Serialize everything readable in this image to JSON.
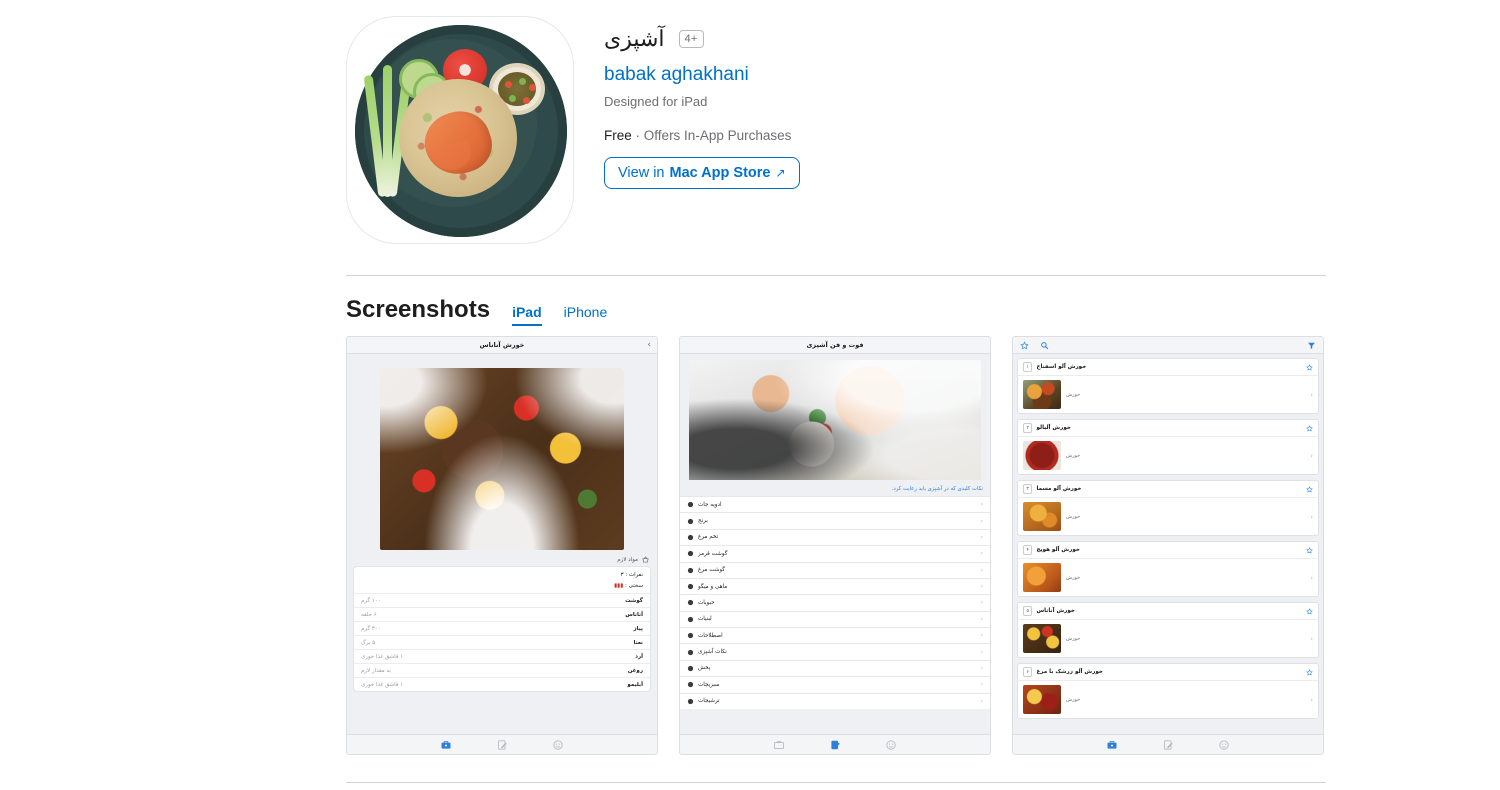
{
  "app": {
    "icon_name": "fried-rice-shrimp-plate",
    "title": "آشپزی",
    "age_rating": "4+",
    "developer": "babak aghakhani",
    "designed_for": "Designed for iPad",
    "price": "Free",
    "separator": "·",
    "in_app_purchases": "Offers In-App Purchases",
    "store_button": {
      "prefix": "View in ",
      "store": "Mac App Store",
      "arrow": "↗"
    }
  },
  "screenshots_section": {
    "heading": "Screenshots",
    "tabs": [
      {
        "label": "iPad",
        "active": true
      },
      {
        "label": "iPhone",
        "active": false
      }
    ]
  },
  "screenshot_1": {
    "title": "خورش آناناس",
    "chevron": "›",
    "ingredients_label": "مواد لازم",
    "servings": "نفرات : ۳",
    "difficulty": "سختی :",
    "rows": [
      {
        "name": "گوشت",
        "qty": "۱۰۰ گرم"
      },
      {
        "name": "آناناس",
        "qty": "۶ حلقه"
      },
      {
        "name": "پیاز",
        "qty": "۳۰۰ گرم"
      },
      {
        "name": "نعنا",
        "qty": "۵ برگ"
      },
      {
        "name": "آرد",
        "qty": "۱ قاشق غذا خوری"
      },
      {
        "name": "روغن",
        "qty": "به مقدار لازم"
      },
      {
        "name": "آبلیمو",
        "qty": "۱ قاشق غذا خوری"
      }
    ],
    "toolbar": [
      "smiley-icon",
      "note-edit-icon",
      "briefcase-icon"
    ],
    "toolbar_active_index": 2
  },
  "screenshot_2": {
    "title": "فوت و فن آشپزی",
    "note": "نکات کلیدی که در آشپزی باید رعایت کرد.",
    "rows": [
      {
        "label": "ادویه جات",
        "icon": "spice-icon"
      },
      {
        "label": "برنج",
        "icon": "rice-icon"
      },
      {
        "label": "تخم مرغ",
        "icon": "egg-icon"
      },
      {
        "label": "گوشت قرمز",
        "icon": "meat-icon"
      },
      {
        "label": "گوشت مرغ",
        "icon": "chicken-icon"
      },
      {
        "label": "ماهی و میگو",
        "icon": "fish-icon"
      },
      {
        "label": "حبوبات",
        "icon": "legume-icon"
      },
      {
        "label": "لبنیات",
        "icon": "dairy-icon"
      },
      {
        "label": "اصطلاحات",
        "icon": "list-icon"
      },
      {
        "label": "نکات آشپزی",
        "icon": "document-icon"
      },
      {
        "label": "پخش",
        "icon": "cook-icon"
      },
      {
        "label": "سبزیجات",
        "icon": "vegetable-icon"
      },
      {
        "label": "ترشیجات",
        "icon": "pickle-icon"
      }
    ],
    "chevron": "‹",
    "toolbar": [
      "smiley-icon",
      "note-edit-icon",
      "briefcase-icon"
    ],
    "toolbar_active_index": 1
  },
  "screenshot_3": {
    "toolbar_top": {
      "star": "star-icon",
      "search": "search-icon",
      "filter": "filter-icon"
    },
    "category": "خورش",
    "chevron": "‹",
    "cards": [
      {
        "num": "۱",
        "name": "خورش آلو اسفناج",
        "thumb": "t1"
      },
      {
        "num": "۲",
        "name": "خورش آلبالو",
        "thumb": "t2"
      },
      {
        "num": "۳",
        "name": "خورش آلو مسما",
        "thumb": "t3"
      },
      {
        "num": "۴",
        "name": "خورش آلو هویج",
        "thumb": "t4"
      },
      {
        "num": "۵",
        "name": "خورش آناناس",
        "thumb": "t5"
      },
      {
        "num": "۶",
        "name": "خورش آلو زرشک با مرغ",
        "thumb": "t6"
      }
    ],
    "toolbar": [
      "smiley-icon",
      "note-edit-icon",
      "briefcase-icon"
    ],
    "toolbar_active_index": 2
  },
  "colors": {
    "link": "#0070c9",
    "text": "#1d1d1f",
    "muted": "#6e6e73",
    "rule": "#d2d2d7"
  }
}
